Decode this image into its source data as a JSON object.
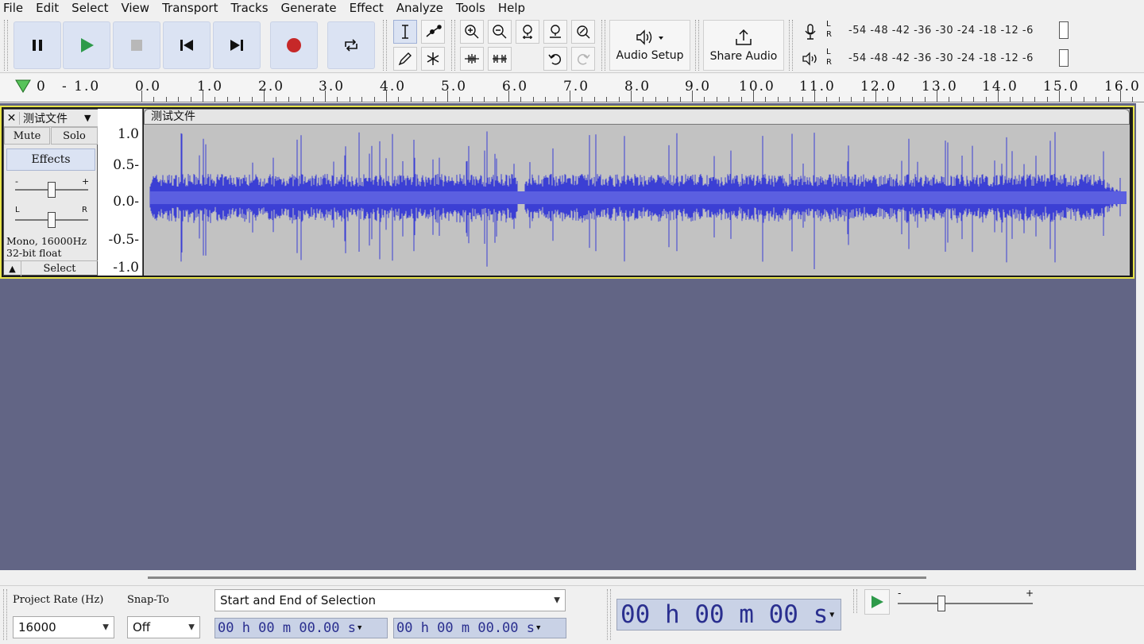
{
  "menu": [
    "File",
    "Edit",
    "Select",
    "View",
    "Transport",
    "Tracks",
    "Generate",
    "Effect",
    "Analyze",
    "Tools",
    "Help"
  ],
  "toolbar": {
    "audio_setup_label": "Audio Setup",
    "share_audio_label": "Share Audio",
    "meter_scale": "-54 -48 -42 -36 -30 -24 -18 -12  -6",
    "record_meter_lr": [
      "L",
      "R"
    ],
    "play_meter_lr": [
      "L",
      "R"
    ]
  },
  "ruler": {
    "labels": [
      "0",
      "- 1.0",
      "0.0",
      "1.0",
      "2.0",
      "3.0",
      "4.0",
      "5.0",
      "6.0",
      "7.0",
      "8.0",
      "9.0",
      "10.0",
      "11.0",
      "12.0",
      "13.0",
      "14.0",
      "15.0",
      "16.0"
    ]
  },
  "track": {
    "name": "测试文件",
    "clip_title": "测试文件",
    "mute_label": "Mute",
    "solo_label": "Solo",
    "effects_label": "Effects",
    "gain_minus": "-",
    "gain_plus": "+",
    "pan_left": "L",
    "pan_right": "R",
    "info_line1": "Mono, 16000Hz",
    "info_line2": "32-bit float",
    "select_label": "Select",
    "scale": [
      "1.0",
      "0.5-",
      "0.0-",
      "-0.5-",
      "-1.0"
    ]
  },
  "bottom": {
    "project_rate_label": "Project Rate (Hz)",
    "project_rate_value": "16000",
    "snap_to_label": "Snap-To",
    "snap_to_value": "Off",
    "selection_mode": "Start and End of Selection",
    "sel_start": "00 h 00 m 00.00 s",
    "sel_end": "00 h 00 m 00.00 s",
    "big_time": "00 h 00 m 00 s",
    "speed_minus": "-",
    "speed_plus": "+"
  },
  "colors": {
    "waveform": "#3b3fd4",
    "clip_bg": "#c2c2c2",
    "track_area_bg": "#626585",
    "selected_border": "#e8e44a",
    "record": "#c62828",
    "play": "#2e9a4a"
  }
}
